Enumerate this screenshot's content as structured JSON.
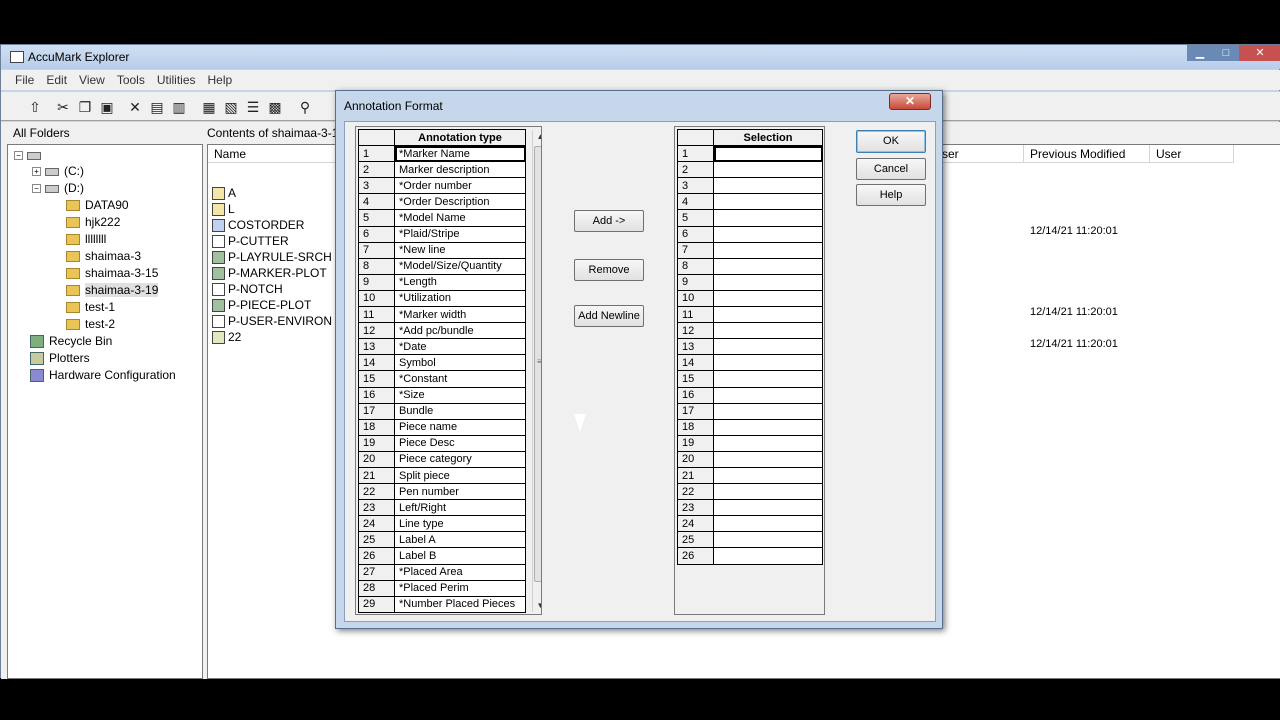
{
  "explorer": {
    "title": "AccuMark Explorer",
    "menu": [
      "File",
      "Edit",
      "View",
      "Tools",
      "Utilities",
      "Help"
    ],
    "folders_header": "All Folders",
    "tree": [
      {
        "label": "(C:)",
        "kind": "drive"
      },
      {
        "label": "(D:)",
        "kind": "drive"
      },
      {
        "label": "DATA90",
        "kind": "folder"
      },
      {
        "label": "hjk222",
        "kind": "folder"
      },
      {
        "label": "llllllll",
        "kind": "folder"
      },
      {
        "label": "shaimaa-3",
        "kind": "folder"
      },
      {
        "label": "shaimaa-3-15",
        "kind": "folder"
      },
      {
        "label": "shaimaa-3-19",
        "kind": "folder",
        "selected": true
      },
      {
        "label": "test-1",
        "kind": "folder"
      },
      {
        "label": "test-2",
        "kind": "folder"
      },
      {
        "label": "Recycle Bin",
        "kind": "special"
      },
      {
        "label": "Plotters",
        "kind": "special"
      },
      {
        "label": "Hardware Configuration",
        "kind": "special"
      }
    ],
    "contents_header": "Contents of shaimaa-3-19",
    "columns": {
      "name": "Name",
      "user_left": "ser",
      "previous_modified": "Previous Modified",
      "user": "User"
    },
    "files": [
      {
        "name": "A",
        "modified": ""
      },
      {
        "name": "L",
        "modified": ""
      },
      {
        "name": "COSTORDER",
        "modified": "12/14/21 11:20:01"
      },
      {
        "name": "P-CUTTER",
        "modified": ""
      },
      {
        "name": "P-LAYRULE-SRCH",
        "modified": ""
      },
      {
        "name": "P-MARKER-PLOT",
        "modified": ""
      },
      {
        "name": "P-NOTCH",
        "modified": "12/14/21 11:20:01"
      },
      {
        "name": "P-PIECE-PLOT",
        "modified": ""
      },
      {
        "name": "P-USER-ENVIRON",
        "modified": "12/14/21 11:20:01"
      },
      {
        "name": "22",
        "modified": ""
      }
    ]
  },
  "dialog": {
    "title": "Annotation Format",
    "close_label": "✕",
    "annotation_header": "Annotation type",
    "annotation_types": [
      "*Marker Name",
      "Marker description",
      "*Order number",
      "*Order Description",
      "*Model Name",
      "*Plaid/Stripe",
      "*New line",
      "*Model/Size/Quantity",
      "*Length",
      "*Utilization",
      "*Marker width",
      "*Add pc/bundle",
      "*Date",
      "Symbol",
      "*Constant",
      "*Size",
      "Bundle",
      "Piece name",
      "Piece Desc",
      "Piece category",
      "Split piece",
      "Pen number",
      "Left/Right",
      "Line type",
      "Label A",
      "Label B",
      "*Placed Area",
      "*Placed Perim",
      "*Number Placed Pieces"
    ],
    "selection_header": "Selection",
    "selection_rows": 26,
    "buttons": {
      "add": "Add ->",
      "remove": "Remove",
      "add_newline": "Add Newline",
      "ok": "OK",
      "cancel": "Cancel",
      "help": "Help"
    }
  }
}
